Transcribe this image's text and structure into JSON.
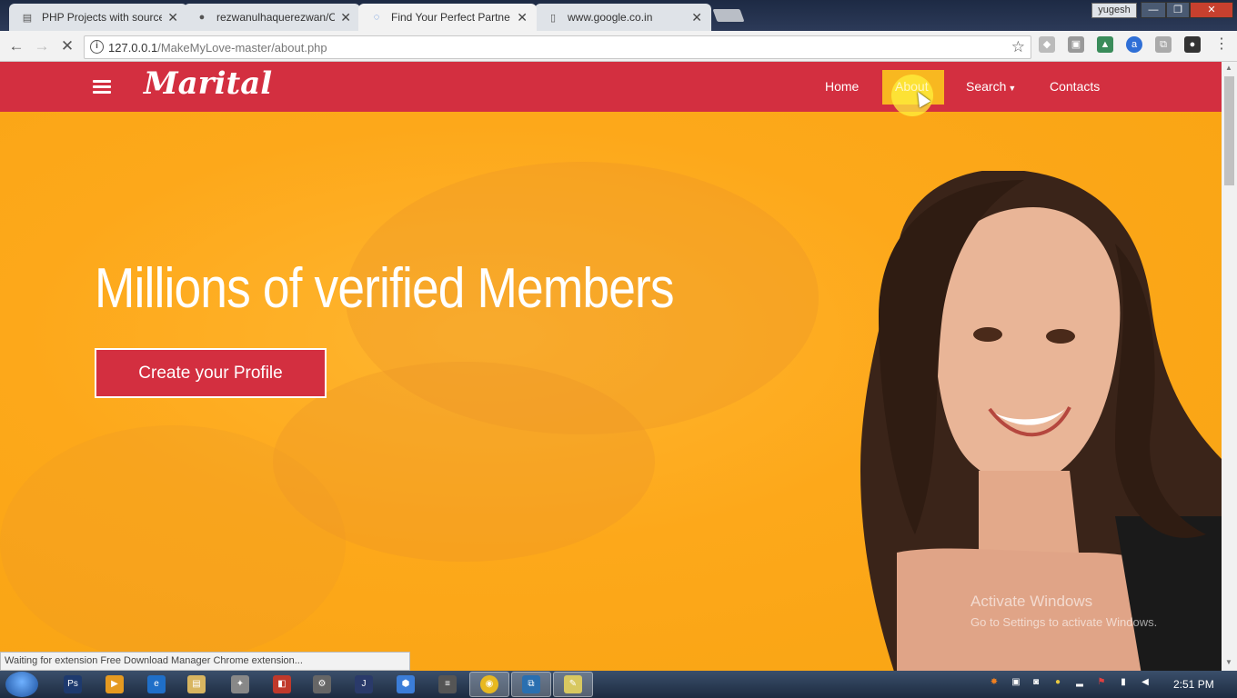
{
  "browser": {
    "tabs": [
      {
        "title": "PHP Projects with source",
        "favicon": "page-icon"
      },
      {
        "title": "rezwanulhaquerezwan/C",
        "favicon": "github-icon"
      },
      {
        "title": "Find Your Perfect Partne",
        "favicon": "loading-spinner-icon"
      },
      {
        "title": "www.google.co.in",
        "favicon": "page-icon"
      }
    ],
    "close_glyph": "✕",
    "user_name": "yugesh",
    "url_host": "127.0.0.1",
    "url_path": "/MakeMyLove-master/about.php",
    "info_glyph": "i",
    "star_glyph": "☆",
    "status_text": "Waiting for extension Free Download Manager Chrome extension...",
    "win_min": "—",
    "win_max": "❐",
    "win_close": "✕"
  },
  "site": {
    "brand": "Marital",
    "nav": [
      "Home",
      "About",
      "Search",
      "Contacts"
    ],
    "headline": "Millions of verified Members",
    "cta_label": "Create your Profile",
    "accent_color": "#d32f40",
    "background_color": "#fda81a"
  },
  "os": {
    "watermark_title": "Activate Windows",
    "watermark_subtitle": "Go to Settings to activate Windows.",
    "clock": "2:51 PM"
  }
}
